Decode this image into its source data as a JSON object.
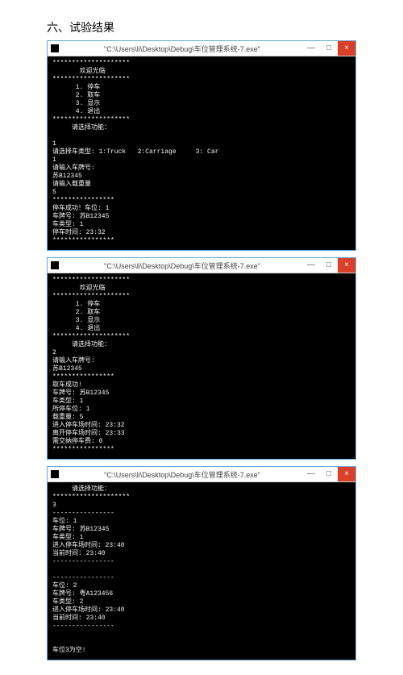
{
  "heading": "六、试验结果",
  "titlebar": {
    "title": "\"C:\\Users\\li\\Desktop\\Debug\\车位管理系统-7.exe\"",
    "min": "—",
    "max": "□",
    "close": "×"
  },
  "consoles": {
    "c1": "********************\n       欢迎光临\n********************\n      1. 停车\n      2. 取车\n      3. 显示\n      4. 退出\n********************\n     请选择功能：\n\n1\n请选择车类型: 1:Truck   2:Carriage     3: Car\n1\n请输入车牌号:\n苏B12345\n请输入载重量\n5\n****************\n停车成功！车位: 1\n车牌号: 苏B12345\n车类型: 1\n停车时间: 23:32\n****************",
    "c2": "********************\n       欢迎光临\n********************\n      1. 停车\n      2. 取车\n      3. 显示\n      4. 退出\n********************\n     请选择功能：\n2\n请输入车牌号:\n苏B12345\n****************\n取车成功!\n车牌号: 苏B12345\n车类型: 1\n所停车位: 1\n载重量: 5\n进入停车场时间: 23:32\n离开停车场时间: 23:33\n需交纳停车费: 0\n****************",
    "c3": "     请选择功能：\n********************\n3\n----------------\n车位: 1\n车牌号: 苏B12345\n车类型: 1\n进入停车场时间: 23:40\n当前时间: 23:40\n----------------\n\n----------------\n车位: 2\n车牌号: 粤A123456\n车类型: 2\n进入停车场时间: 23:40\n当前时间: 23:40\n----------------\n\n\n车位3为空!"
  }
}
